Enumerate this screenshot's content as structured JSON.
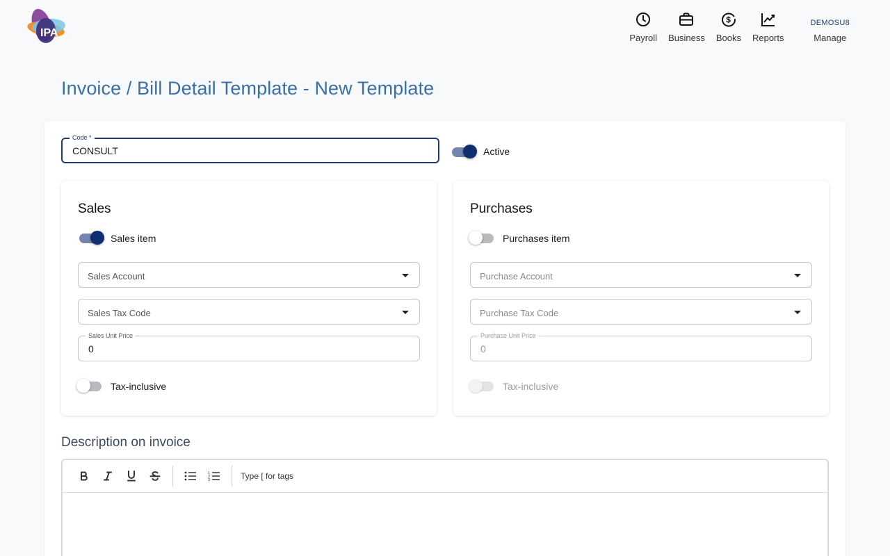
{
  "header": {
    "logo_text": "IPA",
    "nav": [
      {
        "label": "Payroll",
        "icon": "clock-icon"
      },
      {
        "label": "Business",
        "icon": "briefcase-icon"
      },
      {
        "label": "Books",
        "icon": "dollar-refresh-icon"
      },
      {
        "label": "Reports",
        "icon": "trend-chart-icon"
      }
    ],
    "user_code": "DEMOSU8",
    "manage_label": "Manage"
  },
  "page": {
    "title": "Invoice / Bill Detail Template - New Template"
  },
  "form": {
    "code_label": "Code *",
    "code_value": "CONSULT",
    "active_label": "Active",
    "active_on": true
  },
  "sales": {
    "title": "Sales",
    "item_label": "Sales item",
    "item_on": true,
    "account_placeholder": "Sales Account",
    "tax_code_placeholder": "Sales Tax Code",
    "unit_price_label": "Sales Unit Price",
    "unit_price_value": "0",
    "tax_inclusive_label": "Tax-inclusive",
    "tax_inclusive_on": false
  },
  "purchases": {
    "title": "Purchases",
    "item_label": "Purchases item",
    "item_on": false,
    "account_placeholder": "Purchase Account",
    "tax_code_placeholder": "Purchase Tax Code",
    "unit_price_label": "Purchase Unit Price",
    "unit_price_value": "0",
    "tax_inclusive_label": "Tax-inclusive",
    "tax_inclusive_on": false
  },
  "description": {
    "title": "Description on invoice",
    "toolbar_hint": "Type [ for tags",
    "toolbar_buttons": [
      "bold-icon",
      "italic-icon",
      "underline-icon",
      "strikethrough-icon",
      "bullet-list-icon",
      "numbered-list-icon"
    ],
    "body": ""
  },
  "colors": {
    "accent": "#0f2e6e",
    "title": "#3a6fa5",
    "background": "#f7f9fb"
  }
}
